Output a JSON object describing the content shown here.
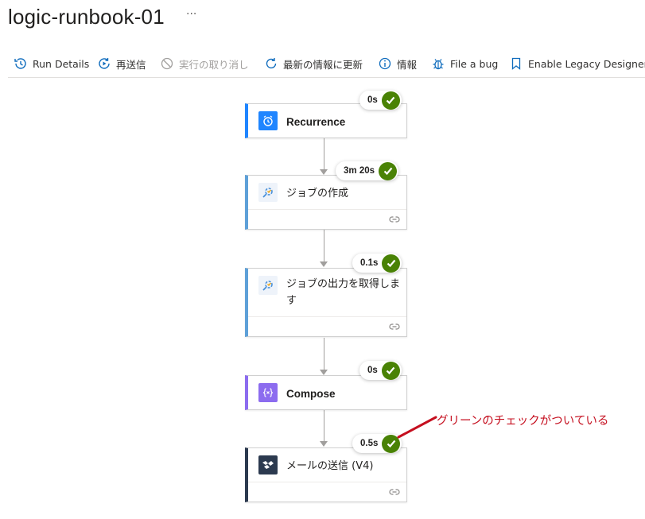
{
  "header": {
    "title": "logic-runbook-01",
    "more": "···"
  },
  "toolbar": {
    "items": [
      {
        "label": "Run Details",
        "icon": "run-details-icon",
        "enabled": true
      },
      {
        "label": "再送信",
        "icon": "resubmit-icon",
        "enabled": true
      },
      {
        "label": "実行の取り消し",
        "icon": "cancel-icon",
        "enabled": false
      },
      {
        "label": "最新の情報に更新",
        "icon": "refresh-icon",
        "enabled": true
      },
      {
        "label": "情報",
        "icon": "info-icon",
        "enabled": true
      },
      {
        "label": "File a bug",
        "icon": "bug-icon",
        "enabled": true
      },
      {
        "label": "Enable Legacy Designer",
        "icon": "bookmark-icon",
        "enabled": true
      }
    ]
  },
  "steps": [
    {
      "label": "Recurrence",
      "duration": "0s",
      "status": "succeeded",
      "icon": "alarm-clock-icon",
      "accent": "#1f85ff"
    },
    {
      "label": "ジョブの作成",
      "duration": "3m 20s",
      "status": "succeeded",
      "icon": "automation-icon",
      "accent": "#5ea0d8"
    },
    {
      "label": "ジョブの出力を取得します",
      "duration": "0.1s",
      "status": "succeeded",
      "icon": "automation-icon",
      "accent": "#5ea0d8"
    },
    {
      "label": "Compose",
      "duration": "0s",
      "status": "succeeded",
      "icon": "compose-icon",
      "accent": "#8c6cef"
    },
    {
      "label": "メールの送信 (V4)",
      "duration": "0.5s",
      "status": "succeeded",
      "icon": "sendgrid-icon",
      "accent": "#2c3a4f"
    }
  ],
  "annotation": {
    "text": "グリーンのチェックがついている",
    "color": "#c50f1f"
  },
  "colors": {
    "success": "#498205",
    "connector": "#a19f9d"
  }
}
